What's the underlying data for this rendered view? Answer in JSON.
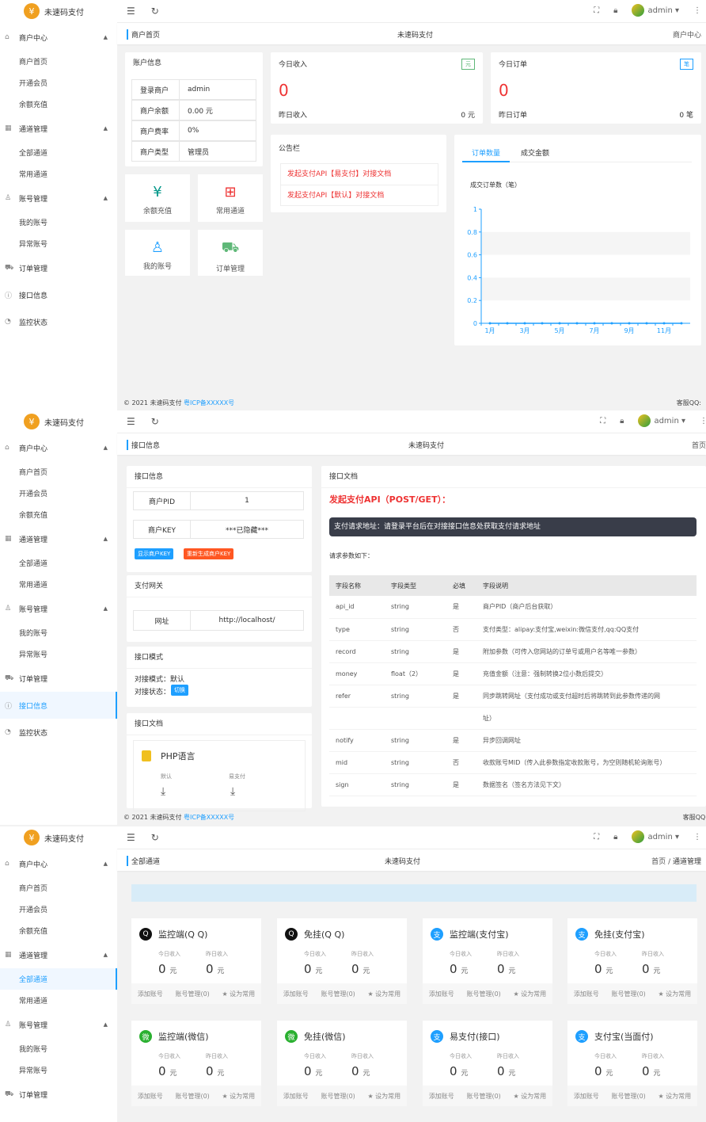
{
  "app": {
    "name": "未速码支付",
    "user": "admin"
  },
  "icons": {
    "menu": "menu-icon",
    "refresh": "refresh-icon",
    "fullscreen": "fullscreen-icon",
    "lock": "lock-icon",
    "more": "more-icon"
  },
  "nav": {
    "merchant": "商户中心",
    "home": "商户首页",
    "vip": "开通会员",
    "recharge": "余额充值",
    "channel": "通道管理",
    "all_channels": "全部通道",
    "common_channels": "常用通道",
    "account": "账号管理",
    "my_accounts": "我的账号",
    "abnormal_accounts": "异常账号",
    "orders": "订单管理",
    "api": "接口信息",
    "monitor": "监控状态"
  },
  "footer": {
    "copyright": "© 2021 未速码支付",
    "icp": "粤ICP备XXXXX号",
    "service": "客服QQ:"
  },
  "p1": {
    "tab": "商户首页",
    "tab_mid": "未速码支付",
    "tab_right": "商户中心",
    "account_title": "账户信息",
    "rows": [
      {
        "k": "登录商户",
        "v": "admin"
      },
      {
        "k": "商户余额",
        "v": "0.00 元"
      },
      {
        "k": "商户费率",
        "v": "0%"
      },
      {
        "k": "商户类型",
        "v": "管理员"
      }
    ],
    "today_income": "今日收入",
    "yuan_tag": "元",
    "income": "0",
    "yesterday_income": "昨日收入",
    "yesterday_income_val": "0 元",
    "today_orders": "今日订单",
    "order_tag": "笔",
    "orders": "0",
    "yesterday_orders": "昨日订单",
    "yesterday_orders_val": "0 笔",
    "tiles": [
      "余额充值",
      "常用通道",
      "我的账号",
      "订单管理"
    ],
    "notice_title": "公告栏",
    "notices": [
      "发起支付API【易支付】对接文档",
      "发起支付API【默认】对接文档"
    ],
    "chart_tabs": [
      "订单数量",
      "成交金额"
    ]
  },
  "chart_data": {
    "type": "line",
    "title": "成交订单数（笔）",
    "categories": [
      "1月",
      "2月",
      "3月",
      "4月",
      "5月",
      "6月",
      "7月",
      "8月",
      "9月",
      "10月",
      "11月",
      "12月"
    ],
    "x_tick_labels": [
      "1月",
      "3月",
      "5月",
      "7月",
      "9月",
      "11月"
    ],
    "series": [
      {
        "values": [
          0,
          0,
          0,
          0,
          0,
          0,
          0,
          0,
          0,
          0,
          0,
          0
        ]
      }
    ],
    "y_ticks": [
      "0",
      "0.2",
      "0.4",
      "0.6",
      "0.8",
      "1"
    ],
    "ylim": [
      0,
      1
    ],
    "grid": true,
    "accent": "#1e9fff"
  },
  "p2": {
    "tab": "接口信息",
    "tab_mid": "未速码支付",
    "tab_right": "首页",
    "info_title": "接口信息",
    "pid_label": "商户PID",
    "pid_value": "1",
    "key_label": "商户KEY",
    "key_value": "***已隐藏***",
    "show_key": "显示商户KEY",
    "regen_key": "重新生成商户KEY",
    "gateway_title": "支付网关",
    "gateway_label": "网址",
    "gateway_value": "http://localhost/",
    "mode_title": "接口模式",
    "mode_line": "对接模式：默认",
    "status_line": "对接状态：",
    "switch_btn": "切换",
    "doc_title": "接口文档",
    "php": "PHP语言",
    "dl_default": "默认",
    "dl_easy": "易支付",
    "doc_header": "接口文档",
    "api_title": "发起支付API（POST/GET）：",
    "api_url": "支付请求地址：请登录平台后在对接接口信息处获取支付请求地址",
    "params_label": "请求参数如下：",
    "cols": [
      "字段名称",
      "字段类型",
      "必填",
      "字段说明"
    ],
    "params": [
      [
        "api_id",
        "string",
        "是",
        "商户PID（商户后台获取）"
      ],
      [
        "type",
        "string",
        "否",
        "支付类型：alipay:支付宝,weixin:微信支付,qq:QQ支付"
      ],
      [
        "record",
        "string",
        "是",
        "附加参数（可传入您网站的订单号或用户名等唯一参数）"
      ],
      [
        "money",
        "float（2）",
        "是",
        "充值金额（注意：强制转换2位小数后提交）"
      ],
      [
        "refer",
        "string",
        "是",
        "同步跳转网址（支付成功或支付超时后将跳转到此参数传递的网"
      ],
      [
        "",
        "",
        "",
        "址）"
      ],
      [
        "notify",
        "string",
        "是",
        "异步回调网址"
      ],
      [
        "mid",
        "string",
        "否",
        "收款账号MID（传入此参数指定收款账号，为空则随机轮询账号）"
      ],
      [
        "sign",
        "string",
        "是",
        "数据签名（签名方法见下文）"
      ]
    ]
  },
  "p3": {
    "tab": "全部通道",
    "tab_mid": "未速码支付",
    "crumb_home": "首页",
    "crumb_sep": "/",
    "crumb_cur": "通道管理",
    "today": "今日收入",
    "yesterday": "昨日收入",
    "zero": "0",
    "yuan": "元",
    "add": "添加账号",
    "manage": "账号管理(0)",
    "fav": "设为常用",
    "channels": [
      {
        "name": "监控端(Q Q)",
        "icon": "qq-icon",
        "glyph": "Q",
        "color": "#111111"
      },
      {
        "name": "免挂(Q Q)",
        "icon": "qq-icon",
        "glyph": "Q",
        "color": "#111111"
      },
      {
        "name": "监控端(支付宝)",
        "icon": "alipay-icon",
        "glyph": "支",
        "color": "#1e9fff"
      },
      {
        "name": "免挂(支付宝)",
        "icon": "alipay-icon",
        "glyph": "支",
        "color": "#1e9fff"
      },
      {
        "name": "监控端(微信)",
        "icon": "wechat-icon",
        "glyph": "微",
        "color": "#2ab030"
      },
      {
        "name": "免挂(微信)",
        "icon": "wechat-icon",
        "glyph": "微",
        "color": "#2ab030"
      },
      {
        "name": "易支付(接口)",
        "icon": "easypay-icon",
        "glyph": "支",
        "color": "#1e9fff"
      },
      {
        "name": "支付宝(当面付)",
        "icon": "alipay-icon",
        "glyph": "支",
        "color": "#1e9fff"
      }
    ]
  }
}
